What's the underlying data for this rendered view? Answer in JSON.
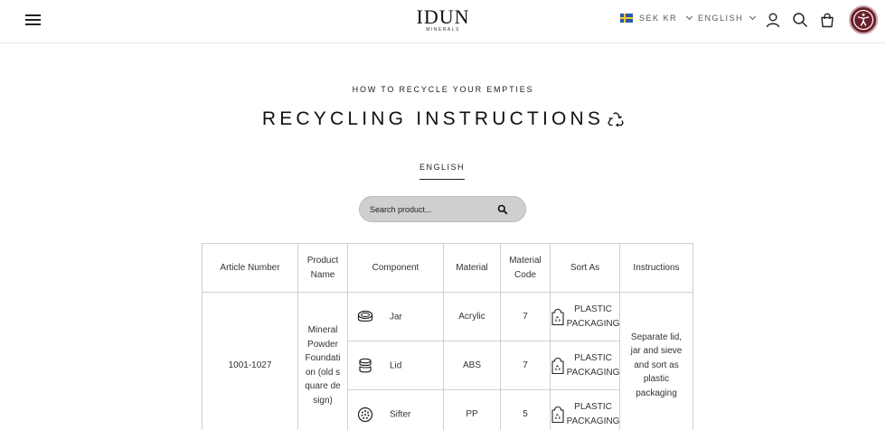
{
  "header": {
    "logo": "IDUN",
    "logo_sub": "MINERALS",
    "currency": "SEK KR",
    "language": "ENGLISH",
    "colors": {
      "accessibility_button": "#6b1f2a"
    }
  },
  "page": {
    "eyebrow": "HOW TO RECYCLE YOUR EMPTIES",
    "title": "RECYCLING INSTRUCTIONS",
    "language_tab": "ENGLISH",
    "search_placeholder": "Search product..."
  },
  "table": {
    "headers": [
      "Article Number",
      "Product Name",
      "Component",
      "Material",
      "Material Code",
      "Sort As",
      "Instructions"
    ],
    "article_number": "1001-1027",
    "product_name": "Mineral Powder Foundation (old square design)",
    "instructions": "Separate lid, jar and sieve and sort as plastic packaging",
    "rows": [
      {
        "component": "Jar",
        "component_icon": "jar-icon",
        "material": "Acrylic",
        "code": "7",
        "sort_as": "PLASTIC PACKAGING"
      },
      {
        "component": "Lid",
        "component_icon": "lid-icon",
        "material": "ABS",
        "code": "7",
        "sort_as": "PLASTIC PACKAGING"
      },
      {
        "component": "Sifter",
        "component_icon": "sifter-icon",
        "material": "PP",
        "code": "5",
        "sort_as": "PLASTIC PACKAGING"
      }
    ]
  }
}
